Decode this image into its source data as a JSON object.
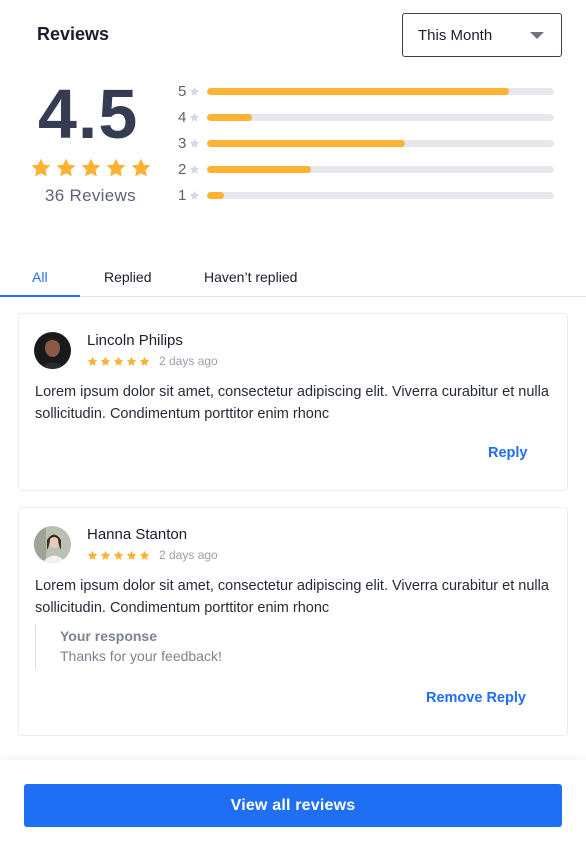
{
  "header": {
    "title": "Reviews",
    "period": "This Month"
  },
  "summary": {
    "rating": "4.5",
    "stars": 5,
    "total": "36 Reviews",
    "distribution": [
      {
        "stars": "5",
        "fraction": 0.87
      },
      {
        "stars": "4",
        "fraction": 0.13
      },
      {
        "stars": "3",
        "fraction": 0.57
      },
      {
        "stars": "2",
        "fraction": 0.3
      },
      {
        "stars": "1",
        "fraction": 0.05
      }
    ]
  },
  "tabs": [
    {
      "label": "All",
      "active": true
    },
    {
      "label": "Replied",
      "active": false
    },
    {
      "label": "Haven’t replied",
      "active": false
    }
  ],
  "reviews": [
    {
      "name": "Lincoln Philips",
      "stars": 5,
      "date": "2 days ago",
      "text": "Lorem ipsum dolor sit amet, consectetur adipiscing elit. Viverra curabitur et nulla sollicitudin. Condimentum porttitor enim rhonc",
      "action": "Reply"
    },
    {
      "name": "Hanna Stanton",
      "stars": 5,
      "date": "2 days ago",
      "text": "Lorem ipsum dolor sit amet, consectetur adipiscing elit. Viverra curabitur et nulla sollicitudin. Condimentum porttitor enim rhonc",
      "response_label": "Your response",
      "response_text": "Thanks for your feedback!",
      "action": "Remove Reply"
    }
  ],
  "footer": {
    "button": "View all reviews"
  },
  "colors": {
    "accent": "#1f6ff5",
    "star": "#fdb234",
    "bar_track": "#e6e7ec"
  }
}
